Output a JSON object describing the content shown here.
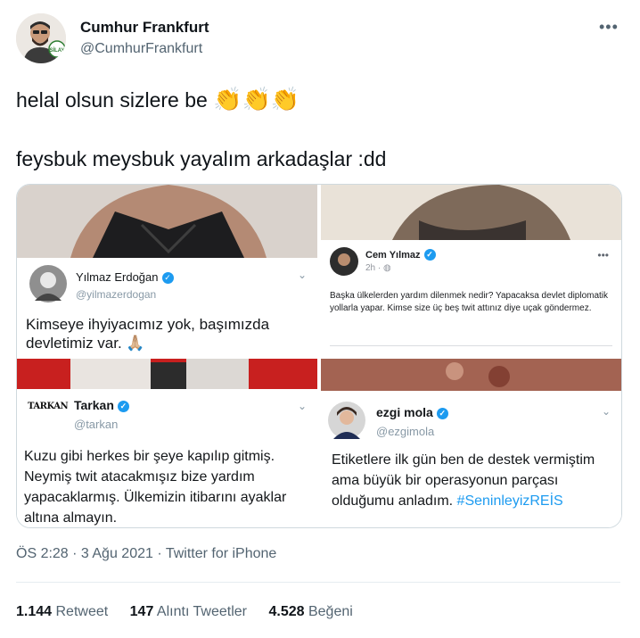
{
  "tweet": {
    "author_name": "Cumhur Frankfurt",
    "author_handle": "@CumhurFrankfurt",
    "line1": "helal olsun sizlere be",
    "line1_emoji": "👏👏👏",
    "line2": "feysbuk meysbuk yayalım arkadaşlar :dd",
    "more_icon": "more-dots-icon",
    "meta": "ÖS 2:28 · 3 Ağu 2021 · Twitter for iPhone"
  },
  "media": {
    "card1": {
      "name": "Yılmaz Erdoğan",
      "handle": "@yilmazerdogan",
      "text": "Kimseye ihyiyacımız yok, başımızda devletimiz var. 🙏🏼"
    },
    "card2": {
      "name": "Cem Yılmaz",
      "time": "2h · ",
      "text": "Başka ülkelerden yardım dilenmek nedir? Yapacaksa devlet diplomatik yollarla yapar. Kimse size üç beş twit attınız diye uçak göndermez."
    },
    "card3": {
      "name": "Tarkan",
      "handle": "@tarkan",
      "logo_text": "TARKAN",
      "text": "Kuzu gibi herkes bir şeye kapılıp gitmiş. Neymiş twit atacakmışız bize yardım yapacaklarmış. Ülkemizin itibarını ayaklar altına almayın."
    },
    "card4": {
      "name": "ezgi mola",
      "handle": "@ezgimola",
      "text": "Etiketlere ilk gün ben de destek vermiştim ama büyük bir operasyonun parçası olduğumu anladım.",
      "hashtag": "#SeninleyizREİS"
    }
  },
  "stats": {
    "retweets_count": "1.144",
    "retweets_label": "Retweet",
    "quotes_count": "147",
    "quotes_label": "Alıntı Tweetler",
    "likes_count": "4.528",
    "likes_label": "Beğeni"
  },
  "colors": {
    "text": "#0f1419",
    "secondary": "#536471",
    "twitter_blue": "#1d9bf0",
    "border": "#cfd9de"
  }
}
